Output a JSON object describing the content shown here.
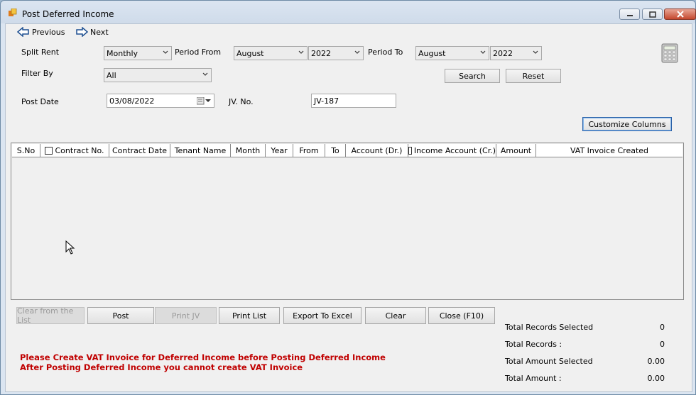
{
  "window": {
    "title": "Post Deferred Income"
  },
  "nav": {
    "previous_label": "Previous",
    "next_label": "Next"
  },
  "filters": {
    "split_rent_label": "Split Rent",
    "split_rent_value": "Monthly",
    "period_from_label": "Period From",
    "period_from_month": "August",
    "period_from_year": "2022",
    "period_to_label": "Period To",
    "period_to_month": "August",
    "period_to_year": "2022",
    "filter_by_label": "Filter By",
    "filter_by_value": "All",
    "search_label": "Search",
    "reset_label": "Reset",
    "post_date_label": "Post Date",
    "post_date_value": "03/08/2022",
    "jv_no_label": "JV. No.",
    "jv_no_value": "JV-187",
    "customize_columns_label": "Customize Columns"
  },
  "grid": {
    "columns": [
      "S.No",
      "Contract No.",
      "Contract Date",
      "Tenant Name",
      "Month",
      "Year",
      "From",
      "To",
      "Account  (Dr.)",
      "Income Account (Cr.)",
      "Amount",
      "VAT Invoice Created"
    ],
    "rows": []
  },
  "actions": {
    "clear_from_list": "Clear from the List",
    "post": "Post",
    "print_jv": "Print JV",
    "print_list": "Print List",
    "export_excel": "Export To Excel",
    "clear": "Clear",
    "close": "Close (F10)"
  },
  "warnings": {
    "line1": "Please Create VAT Invoice for Deferred Income before Posting Deferred Income",
    "line2": "After Posting Deferred Income you cannot create VAT Invoice"
  },
  "summary": {
    "total_records_selected_label": "Total Records  Selected",
    "total_records_selected_value": "0",
    "total_records_label": "Total Records :",
    "total_records_value": "0",
    "total_amount_selected_label": "Total Amount Selected",
    "total_amount_selected_value": "0.00",
    "total_amount_label": "Total Amount :",
    "total_amount_value": "0.00"
  },
  "colors": {
    "warning": "#c00000",
    "title_bg": "#dbe5f1",
    "close_button": "#c4472d"
  }
}
